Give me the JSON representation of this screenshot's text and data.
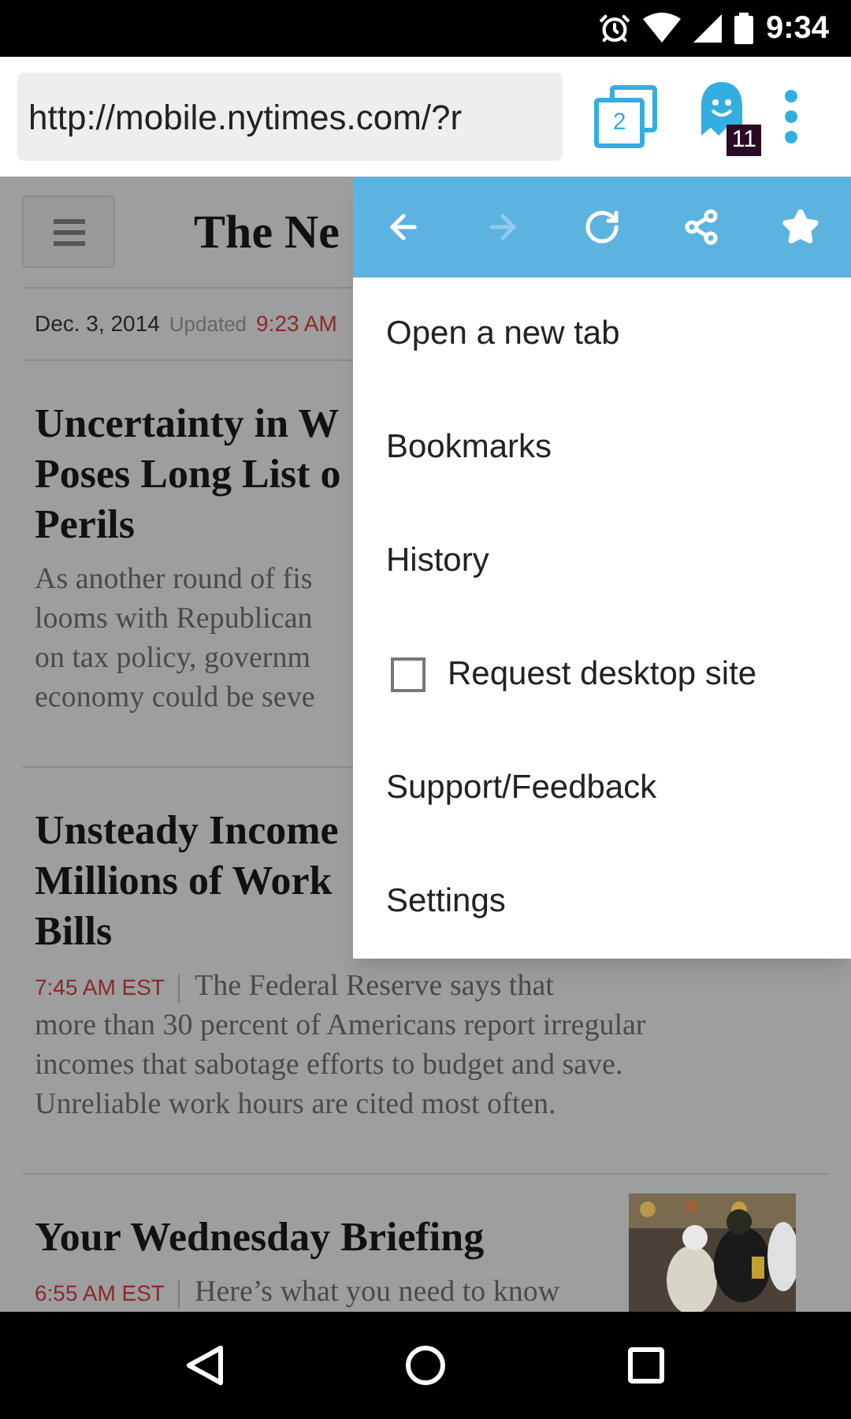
{
  "status_bar": {
    "time": "9:34"
  },
  "toolbar": {
    "url": "http://mobile.nytimes.com/?r",
    "tab_count": "2",
    "ghost_badge": "11"
  },
  "page": {
    "masthead": "The Ne",
    "date": "Dec. 3, 2014",
    "updated_label": "Updated",
    "updated_time": "9:23 AM",
    "articles": [
      {
        "headline_lines": [
          "Uncertainty in W",
          "Poses Long List o",
          "Perils"
        ],
        "summary_lines": [
          "As another round of fis",
          "looms with Republican",
          "on tax policy, governm",
          "economy could be seve"
        ]
      },
      {
        "headline_lines": [
          "Unsteady Income",
          "Millions of Work",
          "Bills"
        ],
        "time": "7:45 AM EST",
        "summary_lines": [
          "The Federal Reserve says that",
          "more than 30 percent of Americans report irregular",
          "incomes that sabotage efforts to budget and save.",
          "Unreliable work hours are cited most often."
        ]
      },
      {
        "headline_lines": [
          "Your Wednesday Briefing"
        ],
        "time": "6:55 AM EST",
        "summary_lines": [
          "Here’s what you need to know"
        ]
      }
    ]
  },
  "menu": {
    "nav_buttons": [
      {
        "kind": "back",
        "disabled": false
      },
      {
        "kind": "forward",
        "disabled": true
      },
      {
        "kind": "reload",
        "disabled": false
      },
      {
        "kind": "share",
        "disabled": false
      },
      {
        "kind": "bookmark",
        "disabled": false
      }
    ],
    "items": [
      {
        "kind": "action",
        "label": "Open a new tab"
      },
      {
        "kind": "action",
        "label": "Bookmarks"
      },
      {
        "kind": "action",
        "label": "History"
      },
      {
        "kind": "checkbox",
        "label": "Request desktop site",
        "checked": false
      },
      {
        "kind": "action",
        "label": "Support/Feedback"
      },
      {
        "kind": "action",
        "label": "Settings"
      }
    ]
  }
}
